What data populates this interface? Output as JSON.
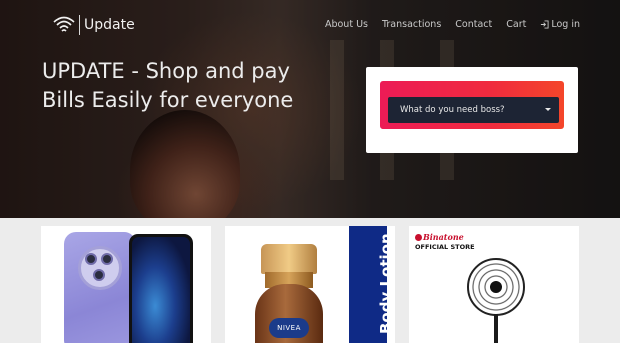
{
  "nav": {
    "brand": "Update",
    "links": [
      "About Us",
      "Transactions",
      "Contact",
      "Cart"
    ],
    "login": "Log in"
  },
  "hero": {
    "headline": "UPDATE - Shop and pay Bills Easily for everyone",
    "select_placeholder": "What do you need boss?"
  },
  "products": {
    "nivea_brand": "NIVEA",
    "nivea_label": "Body Lotion",
    "binatone_brand": "Binatone",
    "binatone_store": "OFFICIAL STORE"
  },
  "icons": {
    "brand": "wifi-signal-icon",
    "login": "login-icon",
    "select_caret": "caret-down-icon"
  },
  "colors": {
    "accent_start": "#ec1b56",
    "accent_end": "#f4462a",
    "select_bg": "#1d2434"
  }
}
